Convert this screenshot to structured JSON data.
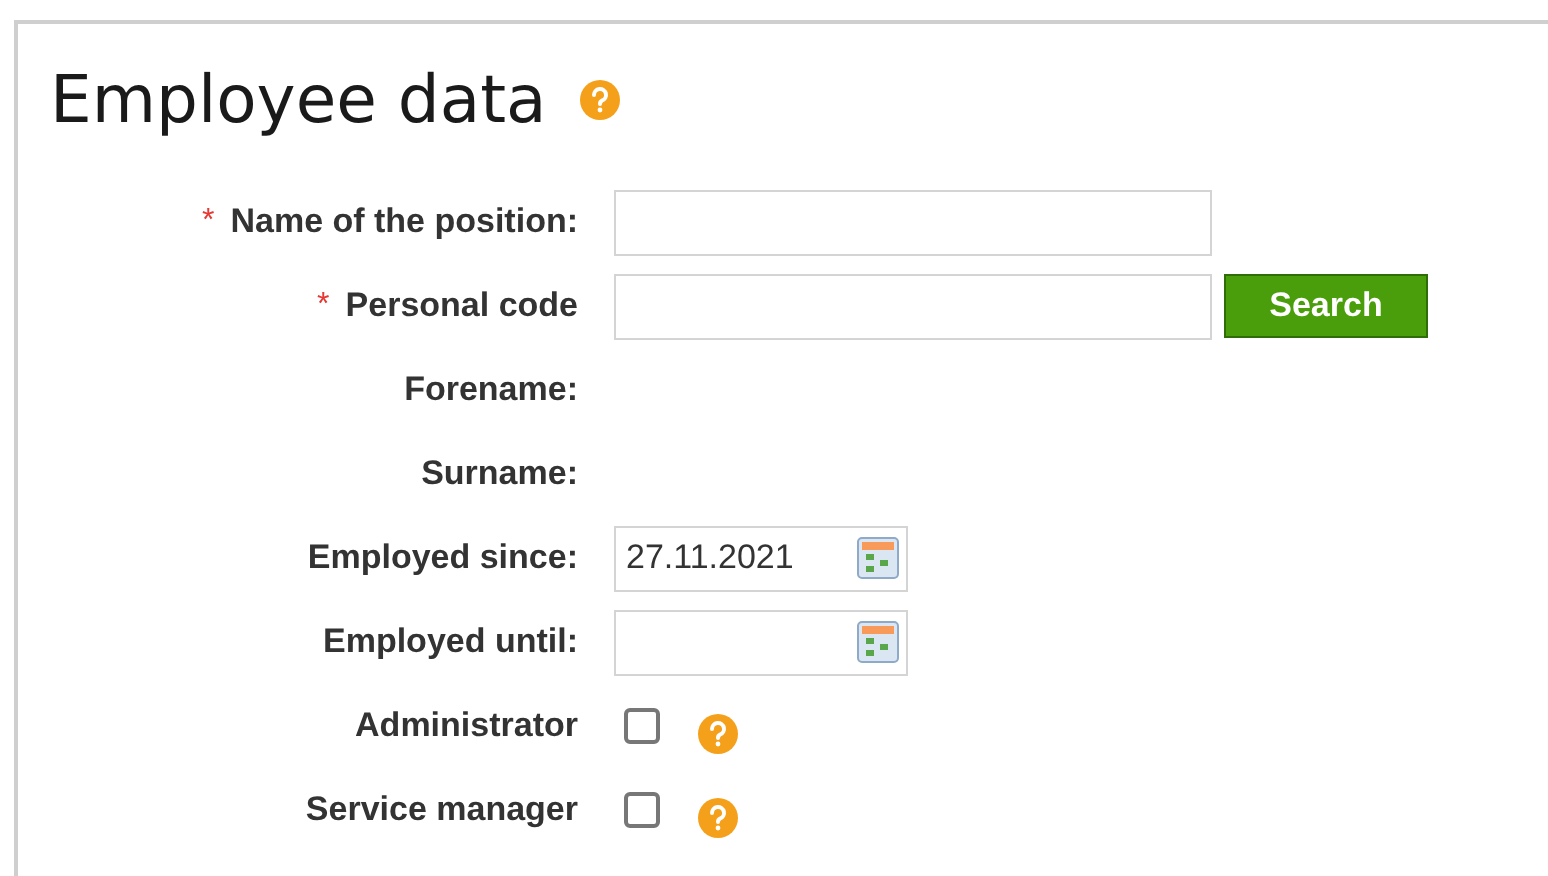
{
  "title": "Employee data",
  "fields": [
    {
      "kind": "text",
      "label": "Name of the position:",
      "required_mark": "*"
    },
    {
      "kind": "text",
      "label": "Personal code",
      "required_mark": "*",
      "button": "Search"
    },
    {
      "kind": "static",
      "label": "Forename:"
    },
    {
      "kind": "static",
      "label": "Surname:"
    },
    {
      "kind": "date",
      "label": "Employed since:",
      "value": "27.11.2021"
    },
    {
      "kind": "date",
      "label": "Employed until:"
    },
    {
      "kind": "checkbox",
      "label": "Administrator",
      "checked": false
    },
    {
      "kind": "checkbox",
      "label": "Service manager",
      "checked": false
    }
  ]
}
